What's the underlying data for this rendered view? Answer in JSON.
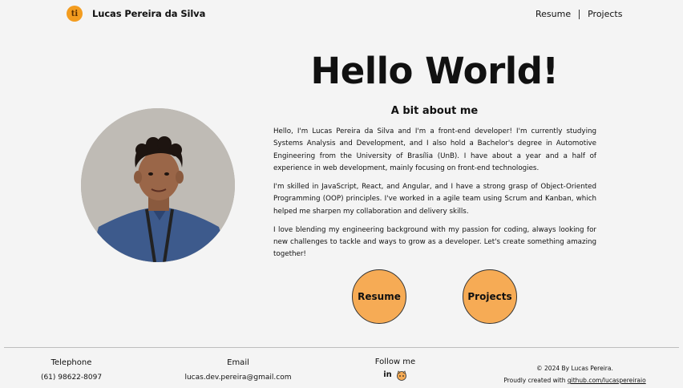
{
  "header": {
    "logo_text": "ti",
    "brand_name": "Lucas Pereira da Silva",
    "nav": [
      {
        "label": "Resume"
      },
      {
        "label": "Projects"
      }
    ]
  },
  "hero": {
    "title": "Hello World!",
    "about_title": "A bit about me",
    "paragraphs": [
      "Hello, I'm Lucas Pereira da Silva and I'm a front-end developer! I'm currently studying Systems Analysis and Development, and I also hold a Bachelor's degree in Automotive Engineering from the University of Brasília (UnB). I have about a year and a half of experience in web development, mainly focusing on front-end technologies.",
      "I'm skilled in JavaScript, React, and Angular, and I have a strong grasp of Object-Oriented Programming (OOP) principles. I've worked in a agile team using Scrum and Kanban, which helped me sharpen my collaboration and delivery skills.",
      "I love blending my engineering background with my passion for coding, always looking for new challenges to tackle and ways to grow as a developer. Let's create something amazing together!"
    ],
    "buttons": {
      "resume": "Resume",
      "projects": "Projects"
    }
  },
  "footer": {
    "telephone": {
      "heading": "Telephone",
      "value": "(61) 98622-8097"
    },
    "email": {
      "heading": "Email",
      "value": "lucas.dev.pereira@gmail.com"
    },
    "follow": {
      "heading": "Follow me",
      "icons": [
        "linkedin-icon",
        "github-octocat-icon"
      ]
    },
    "copyright": "© 2024 By Lucas Pereira.",
    "credit_prefix": "Proudly created with",
    "credit_link": "github.com/lucaspereiraio"
  },
  "colors": {
    "background": "#f4f4f4",
    "accent": "#f6ab55",
    "logo": "#f39c1f"
  }
}
